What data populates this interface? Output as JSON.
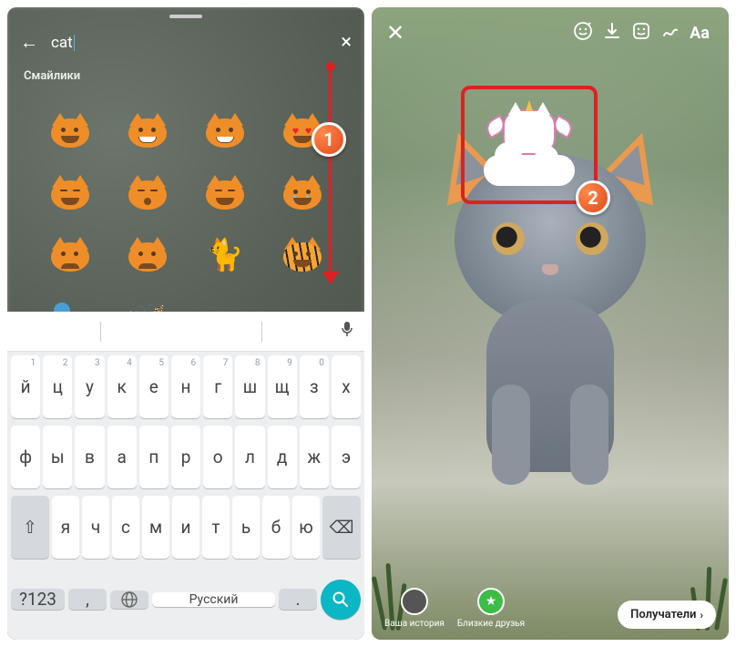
{
  "left": {
    "search": {
      "query": "cat"
    },
    "section_label": "Смайлики",
    "emoji": [
      {
        "name": "cat-face-open-mouth",
        "variant": "open"
      },
      {
        "name": "cat-face-grin",
        "variant": "grin"
      },
      {
        "name": "cat-face-laugh",
        "variant": "grin"
      },
      {
        "name": "cat-face-heart-eyes",
        "variant": "love"
      },
      {
        "name": "cat-face-smirk",
        "variant": "closed"
      },
      {
        "name": "cat-face-kiss",
        "variant": "kiss"
      },
      {
        "name": "cat-face-tired",
        "variant": "closed"
      },
      {
        "name": "cat-face-cry",
        "variant": "cry"
      },
      {
        "name": "cat-face-sad",
        "variant": "sad"
      },
      {
        "name": "cat-face-angry",
        "variant": "sad"
      },
      {
        "name": "kitten",
        "glyph": "🐈"
      },
      {
        "name": "tiger-face",
        "variant": "tiger"
      },
      {
        "name": "paw-prints",
        "variant": "paws"
      },
      {
        "name": "butterfly",
        "glyph": "🦋"
      }
    ],
    "badge": "1",
    "keyboard": {
      "row1": [
        {
          "k": "й",
          "n": "1"
        },
        {
          "k": "ц",
          "n": "2"
        },
        {
          "k": "у",
          "n": "3"
        },
        {
          "k": "к",
          "n": "4"
        },
        {
          "k": "е",
          "n": "5"
        },
        {
          "k": "н",
          "n": "6"
        },
        {
          "k": "г",
          "n": "7"
        },
        {
          "k": "ш",
          "n": "8"
        },
        {
          "k": "щ",
          "n": "9"
        },
        {
          "k": "з",
          "n": "0"
        },
        {
          "k": "х",
          "n": ""
        }
      ],
      "row2": [
        "ф",
        "ы",
        "в",
        "а",
        "п",
        "р",
        "о",
        "л",
        "д",
        "ж",
        "э"
      ],
      "row3": [
        "я",
        "ч",
        "с",
        "м",
        "и",
        "т",
        "ь",
        "б",
        "ю"
      ],
      "shift": "⇧",
      "backspace": "⌫",
      "symbols": "?123",
      "comma": ",",
      "globe": "🌐",
      "space_label": "Русский",
      "period": ".",
      "search_icon": "search"
    }
  },
  "right": {
    "toolbar": {
      "close": "✕",
      "icons": [
        "face-sticker",
        "download",
        "sticker",
        "draw",
        "text"
      ]
    },
    "text_tool_label": "Aa",
    "badge": "2",
    "bottom": {
      "your_story": "Ваша история",
      "close_friends": "Близкие друзья",
      "recipients": "Получатели"
    }
  }
}
